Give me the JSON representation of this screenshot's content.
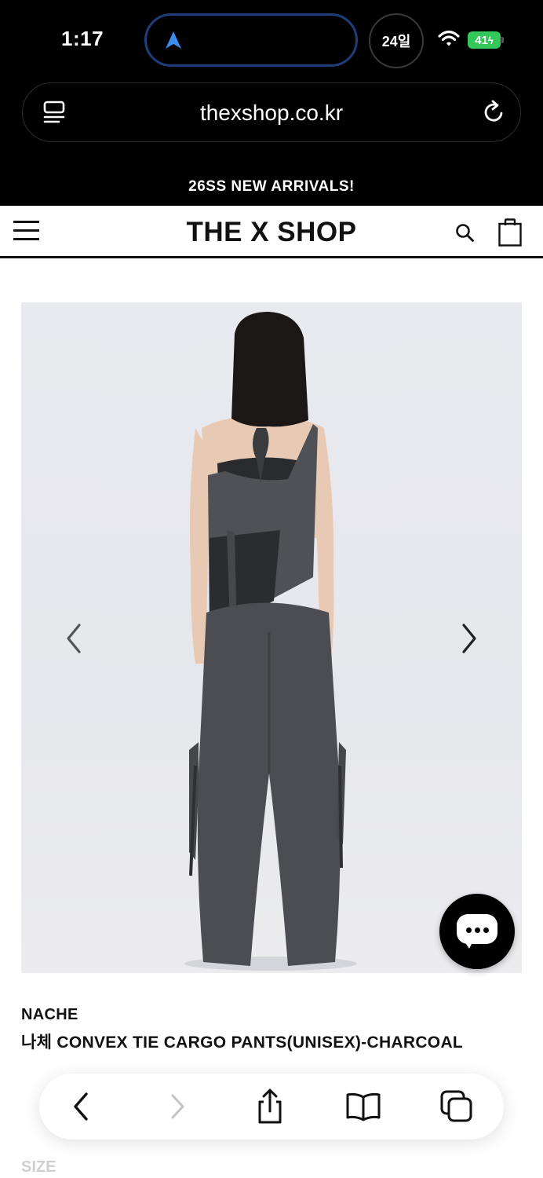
{
  "status_bar": {
    "time": "1:17",
    "date_badge": "24일",
    "battery": "41",
    "icons": [
      "navigation-arrow-icon",
      "wifi-icon",
      "battery-icon"
    ]
  },
  "browser": {
    "url": "thexshop.co.kr",
    "icons": [
      "reader-icon",
      "reload-icon"
    ]
  },
  "announcement": "26SS NEW ARRIVALS!",
  "header": {
    "logo": "THE X SHOP",
    "icons": [
      "menu-icon",
      "search-icon",
      "bag-icon"
    ]
  },
  "product": {
    "brand": "NACHE",
    "name": "나체 CONVEX TIE CARGO PANTS(UNISEX)-CHARCOAL",
    "size_label": "SIZE",
    "image_icons": [
      "chevron-left-icon",
      "chevron-right-icon"
    ]
  },
  "chat": {
    "icon": "chat-icon"
  },
  "toolbar": {
    "icons": [
      "back-icon",
      "forward-icon",
      "share-icon",
      "bookmarks-icon",
      "tabs-icon"
    ]
  },
  "colors": {
    "accent_blue": "#3a8cf0",
    "battery_green": "#34c759",
    "garment_charcoal": "#4b4d52"
  }
}
